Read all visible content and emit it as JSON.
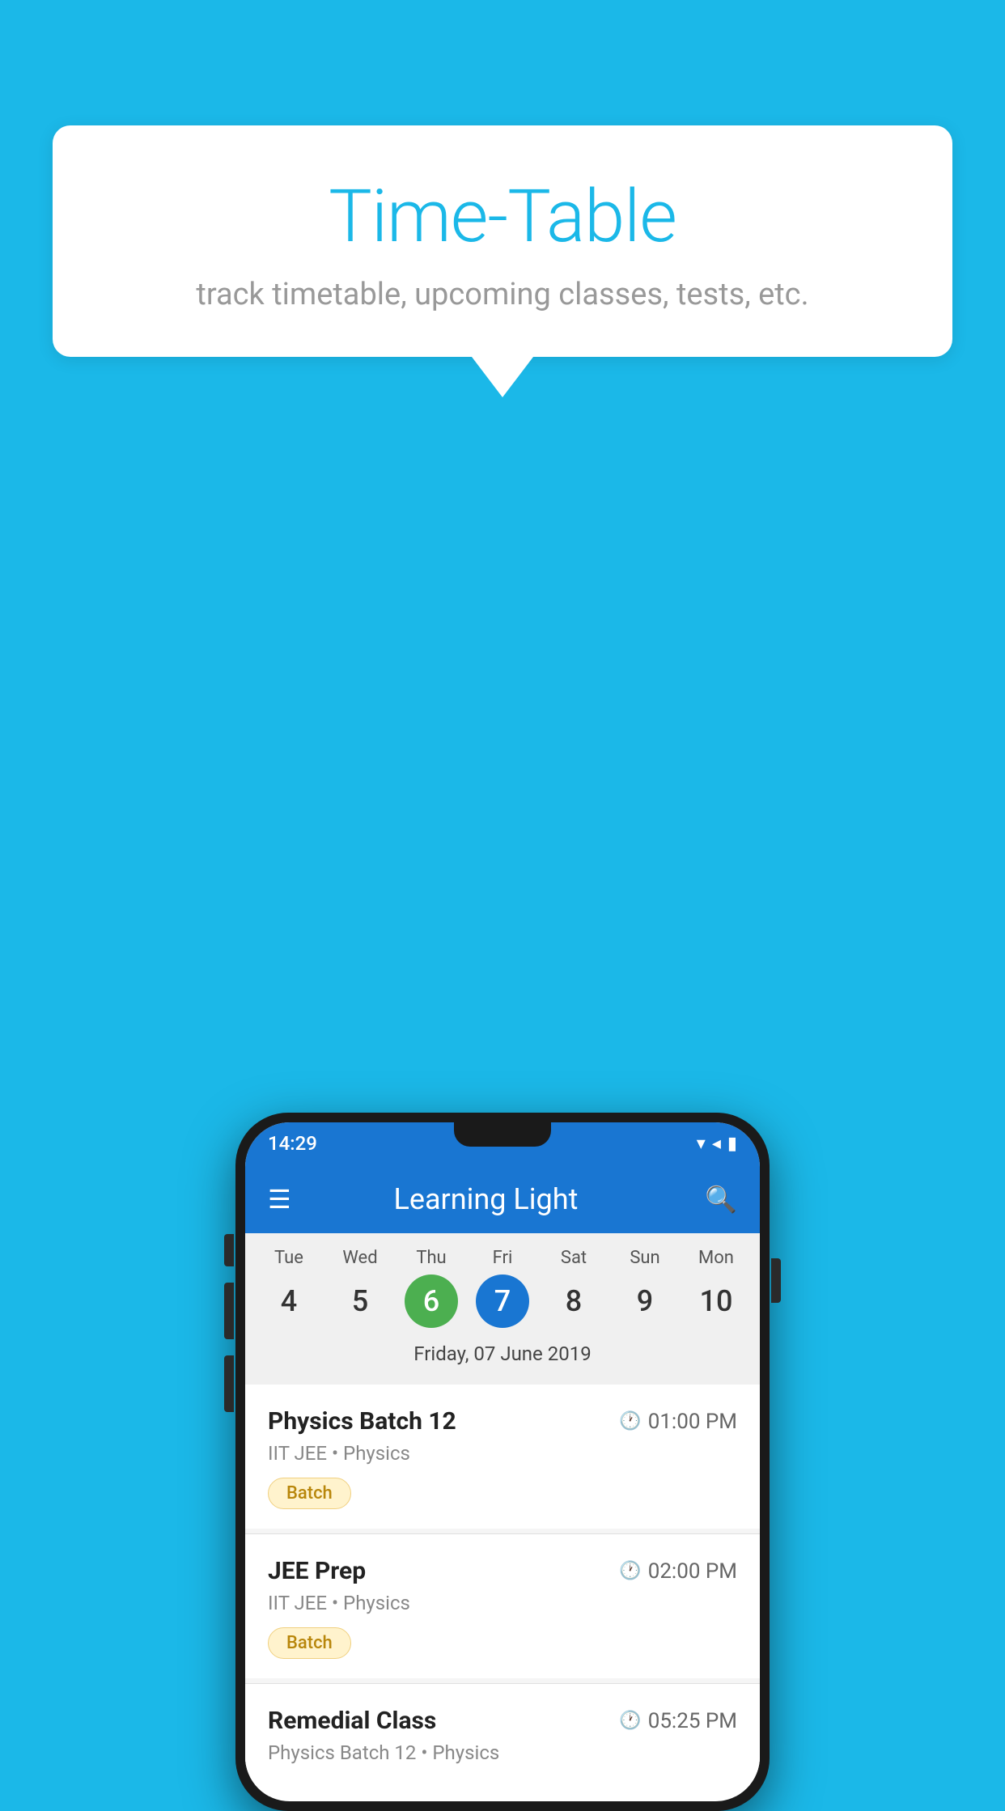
{
  "background_color": "#1BB8E8",
  "bubble": {
    "title": "Time-Table",
    "subtitle": "track timetable, upcoming classes, tests, etc."
  },
  "phone": {
    "status_bar": {
      "time": "14:29"
    },
    "app_bar": {
      "title": "Learning Light"
    },
    "calendar": {
      "days": [
        {
          "name": "Tue",
          "num": "4",
          "state": "normal"
        },
        {
          "name": "Wed",
          "num": "5",
          "state": "normal"
        },
        {
          "name": "Thu",
          "num": "6",
          "state": "today"
        },
        {
          "name": "Fri",
          "num": "7",
          "state": "selected"
        },
        {
          "name": "Sat",
          "num": "8",
          "state": "normal"
        },
        {
          "name": "Sun",
          "num": "9",
          "state": "normal"
        },
        {
          "name": "Mon",
          "num": "10",
          "state": "normal"
        }
      ],
      "selected_date_label": "Friday, 07 June 2019"
    },
    "schedule": [
      {
        "title": "Physics Batch 12",
        "time": "01:00 PM",
        "subtitle": "IIT JEE • Physics",
        "badge": "Batch"
      },
      {
        "title": "JEE Prep",
        "time": "02:00 PM",
        "subtitle": "IIT JEE • Physics",
        "badge": "Batch"
      },
      {
        "title": "Remedial Class",
        "time": "05:25 PM",
        "subtitle": "Physics Batch 12 • Physics",
        "badge": null
      }
    ]
  }
}
